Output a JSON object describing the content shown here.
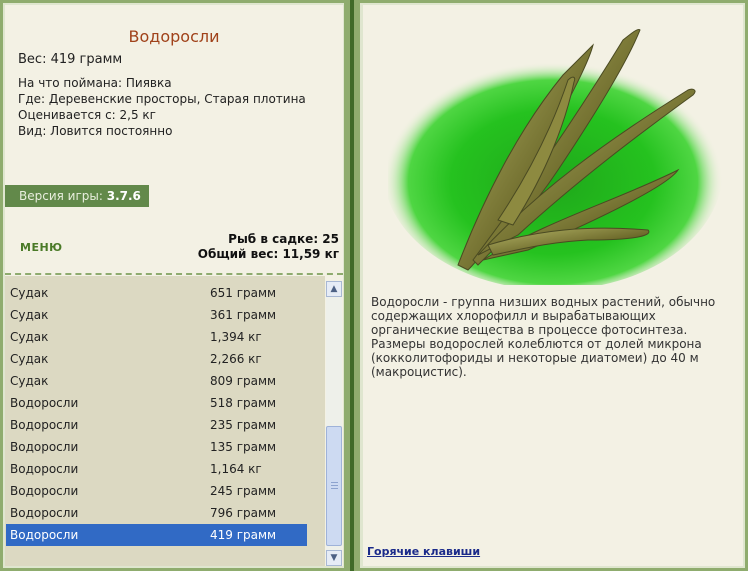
{
  "fish": {
    "title": "Водоросли",
    "weight": "Вес: 419 грамм",
    "caught_with": "На что поймана: Пиявка",
    "location": "Где: Деревенские просторы, Старая плотина",
    "value": "Оценивается с: 2,5 кг",
    "kind": "Вид: Ловится постоянно"
  },
  "version": {
    "label": "Версия игры: ",
    "number": "3.7.6"
  },
  "menu": {
    "label": "МЕНЮ"
  },
  "keep": {
    "count": "Рыб в садке: 25",
    "total": "Общий вес: 11,59 кг"
  },
  "catch_list": [
    {
      "name": "Судак",
      "weight": "651 грамм"
    },
    {
      "name": "Судак",
      "weight": "361 грамм"
    },
    {
      "name": "Судак",
      "weight": "1,394 кг"
    },
    {
      "name": "Судак",
      "weight": "2,266 кг"
    },
    {
      "name": "Судак",
      "weight": "809 грамм"
    },
    {
      "name": "Водоросли",
      "weight": "518 грамм"
    },
    {
      "name": "Водоросли",
      "weight": "235 грамм"
    },
    {
      "name": "Водоросли",
      "weight": "135 грамм"
    },
    {
      "name": "Водоросли",
      "weight": "1,164 кг"
    },
    {
      "name": "Водоросли",
      "weight": "245 грамм"
    },
    {
      "name": "Водоросли",
      "weight": "796 грамм"
    },
    {
      "name": "Водоросли",
      "weight": "419 грамм"
    }
  ],
  "selected_index": 11,
  "description": "Водоросли - группа низших водных растений, обычно содержащих хлорофилл и вырабатывающих органические вещества в процессе фотосинтеза. Размеры водорослей колеблются от долей микрона (кокколитофориды и некоторые диатомеи) до 40 м (макроцистис).",
  "hotkeys": {
    "label": "Горячие клавиши"
  },
  "icons": {
    "scroll_up": "scroll-up-arrow-icon",
    "scroll_down": "scroll-down-arrow-icon"
  },
  "colors": {
    "frame": "#4f7a35",
    "panel": "#f3f1e4",
    "title": "#a0421a",
    "selection": "#316ac5",
    "badge": "#62894a"
  }
}
